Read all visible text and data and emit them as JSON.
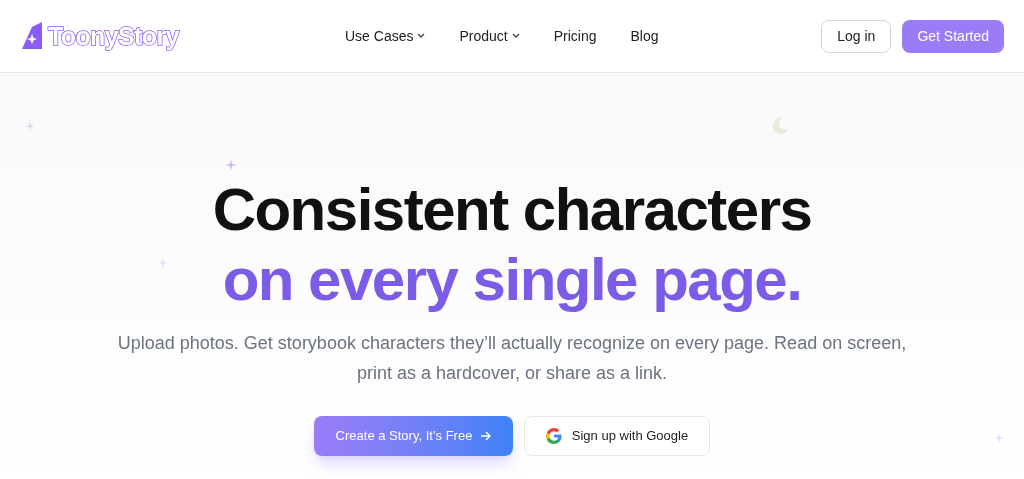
{
  "logo": {
    "text": "ToonyStory"
  },
  "nav": [
    {
      "label": "Use Cases",
      "dropdown": true
    },
    {
      "label": "Product",
      "dropdown": true
    },
    {
      "label": "Pricing",
      "dropdown": false
    },
    {
      "label": "Blog",
      "dropdown": false
    }
  ],
  "header_buttons": [
    {
      "label": "Log in",
      "kind": "outline"
    },
    {
      "label": "Get Started",
      "kind": "primary"
    }
  ],
  "hero": {
    "headline": "Consistent characters",
    "headline_accent": "on every single page.",
    "subtitle": "Upload photos. Get storybook characters they’ll actually recognize on every page. Read on screen, print as a hardcover, or share as a link.",
    "buttons": [
      {
        "label": "Create a Story, It’s Free",
        "kind": "gradient"
      },
      {
        "label": "Sign up with Google",
        "kind": "google"
      }
    ]
  }
}
